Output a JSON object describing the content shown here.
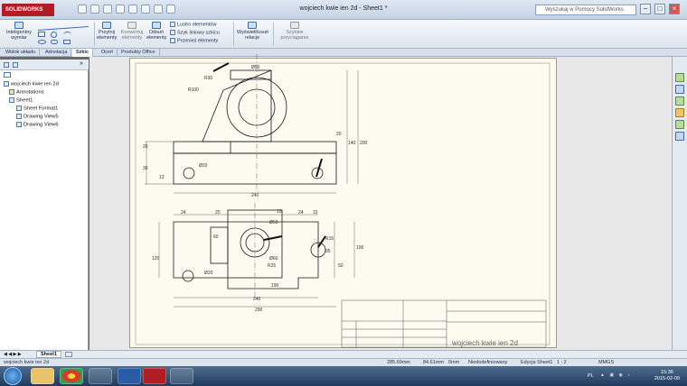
{
  "app": {
    "brand": "SOLIDWORKS",
    "title": "wojciech kwie ien 2d - Sheet1 *"
  },
  "search": {
    "placeholder": "Wyszukaj w Pomocy SolidWorks"
  },
  "ribbon": {
    "smart_dim": "Inteligentny wymiar",
    "mirror": "Przytnij elementy",
    "convert": "Konwertuj elementy",
    "offset": "Odsuń elementy",
    "mirror_entities": "Lustro elementów",
    "linear_pattern": "Szyk liniowy szkicu",
    "move_entities": "Przenieś elementy",
    "show_relations": "Wyświetl/usuń relacje",
    "quick_snaps": "Szybkie przyciąganie"
  },
  "tabs": [
    "Widok układu",
    "Adnotacja",
    "Szkic",
    "Oceń",
    "Produkty Office"
  ],
  "tabs_active": "Szkic",
  "tree": {
    "root": "wojciech kwie ien 2d",
    "annotations": "Annotations",
    "sheet": "Sheet1",
    "sheet_format": "Sheet Format1",
    "view5": "Drawing View5",
    "view6": "Drawing View6"
  },
  "drawing": {
    "top": {
      "d1": "Ø50",
      "d2": "R100",
      "d3": "R30",
      "d4": "Ø20",
      "d5": "240",
      "d6": "20",
      "d7": "30",
      "d8": "13",
      "d9": "20",
      "d10": "140",
      "d11": "200"
    },
    "bottom": {
      "d1": "24",
      "d2": "20",
      "d3": "24",
      "d4": "15",
      "d5": "Ø50",
      "d6": "Ø60",
      "d7": "R25",
      "d8": "R15",
      "d9": "Ø20",
      "d10": "120",
      "d11": "60",
      "d12": "10",
      "d13": "95",
      "d14": "100",
      "d15": "50",
      "d16": "190",
      "d17": "240",
      "d18": "290"
    },
    "block_name": "wojciech kwie ien 2d"
  },
  "sheet_tab": "Sheet1",
  "status": {
    "name": "wojciech kwie ien 2d",
    "x": "285.69mm",
    "y": "84.61mm",
    "z": "0mm",
    "state": "Niedodefiniowany",
    "edit": "Edycja Sheet1",
    "scale": "1 : 2",
    "units": "MMGS"
  },
  "clock": {
    "lang": "PL",
    "time": "15:36",
    "date": "2015-02-09"
  },
  "colors": {
    "brand": "#b01e24",
    "sheet": "#fbfbef",
    "line": "#1a1a1a",
    "dim": "#555555"
  }
}
